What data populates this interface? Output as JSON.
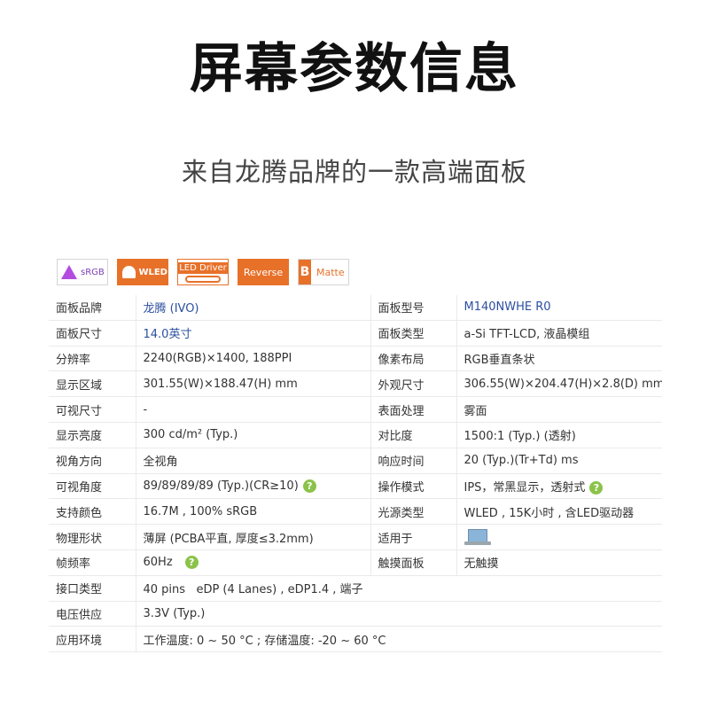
{
  "header": {
    "title": "屏幕参数信息",
    "subtitle": "来自龙腾品牌的一款高端面板"
  },
  "badges": {
    "srgb": "sRGB",
    "wled": "WLED",
    "led_driver": "LED Driver",
    "reverse": "Reverse",
    "matte_letter": "B",
    "matte": "Matte"
  },
  "colors": {
    "accent": "#e8712a",
    "link": "#2b4fa0",
    "help": "#8bc34a"
  },
  "specs": {
    "r1": {
      "k1": "面板品牌",
      "v1": "龙腾 (IVO)",
      "k2": "面板型号",
      "v2": "M140NWHE R0"
    },
    "r2": {
      "k1": "面板尺寸",
      "v1": "14.0英寸",
      "k2": "面板类型",
      "v2": "a-Si TFT-LCD, 液晶模组"
    },
    "r3": {
      "k1": "分辨率",
      "v1": "2240(RGB)×1400, 188PPI",
      "k2": "像素布局",
      "v2": "RGB垂直条状"
    },
    "r4": {
      "k1": "显示区域",
      "v1": "301.55(W)×188.47(H) mm",
      "k2": "外观尺寸",
      "v2": "306.55(W)×204.47(H)×2.8(D) mm"
    },
    "r5": {
      "k1": "可视尺寸",
      "v1": "-",
      "k2": "表面处理",
      "v2": "雾面"
    },
    "r6": {
      "k1": "显示亮度",
      "v1": "300 cd/m² (Typ.)",
      "k2": "对比度",
      "v2": "1500:1 (Typ.) (透射)"
    },
    "r7": {
      "k1": "视角方向",
      "v1": "全视角",
      "k2": "响应时间",
      "v2": "20 (Typ.)(Tr+Td) ms"
    },
    "r8": {
      "k1": "可视角度",
      "v1": "89/89/89/89 (Typ.)(CR≥10)",
      "k2": "操作模式",
      "v2": "IPS，常黑显示，透射式"
    },
    "r9": {
      "k1": "支持颜色",
      "v1": "16.7M , 100% sRGB",
      "k2": "光源类型",
      "v2": "WLED , 15K小时 , 含LED驱动器"
    },
    "r10": {
      "k1": "物理形状",
      "v1": "薄屏 (PCBA平直, 厚度≤3.2mm)",
      "k2": "适用于"
    },
    "r11": {
      "k1": "帧频率",
      "v1": "60Hz",
      "k2": "触摸面板",
      "v2": "无触摸"
    },
    "r12": {
      "k1": "接口类型",
      "v1": "40 pins   eDP (4 Lanes) , eDP1.4 , 端子"
    },
    "r13": {
      "k1": "电压供应",
      "v1": "3.3V (Typ.)"
    },
    "r14": {
      "k1": "应用环境",
      "v1": "工作温度: 0 ~ 50 °C ; 存储温度: -20 ~ 60 °C"
    },
    "help_mark": "?"
  }
}
